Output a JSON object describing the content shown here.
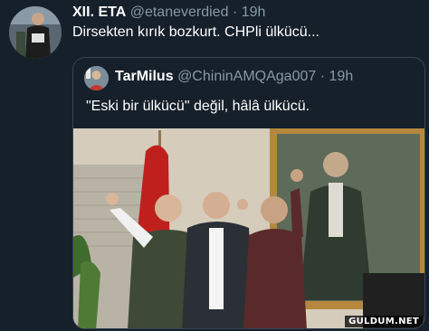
{
  "tweet": {
    "author_name": "XII. ETA",
    "author_handle": "@etaneverdied",
    "separator": "·",
    "time": "19h",
    "text": "Dirsekten kırık bozkurt. CHPli ülkücü...",
    "avatar_icon": "profile-photo-avatar"
  },
  "quoted_tweet": {
    "author_name": "TarMilus",
    "author_handle": "@ChininAMQAga007",
    "separator": "·",
    "time": "19h",
    "text": "\"Eski bir ülkücü\" değil, hâlâ ülkücü.",
    "avatar_icon": "profile-photo-avatar",
    "photo_icon": "group-photo"
  },
  "watermark": "GULDUM.NET",
  "colors": {
    "background": "#15202b",
    "secondary_text": "#8899a6",
    "border": "#38444d"
  }
}
